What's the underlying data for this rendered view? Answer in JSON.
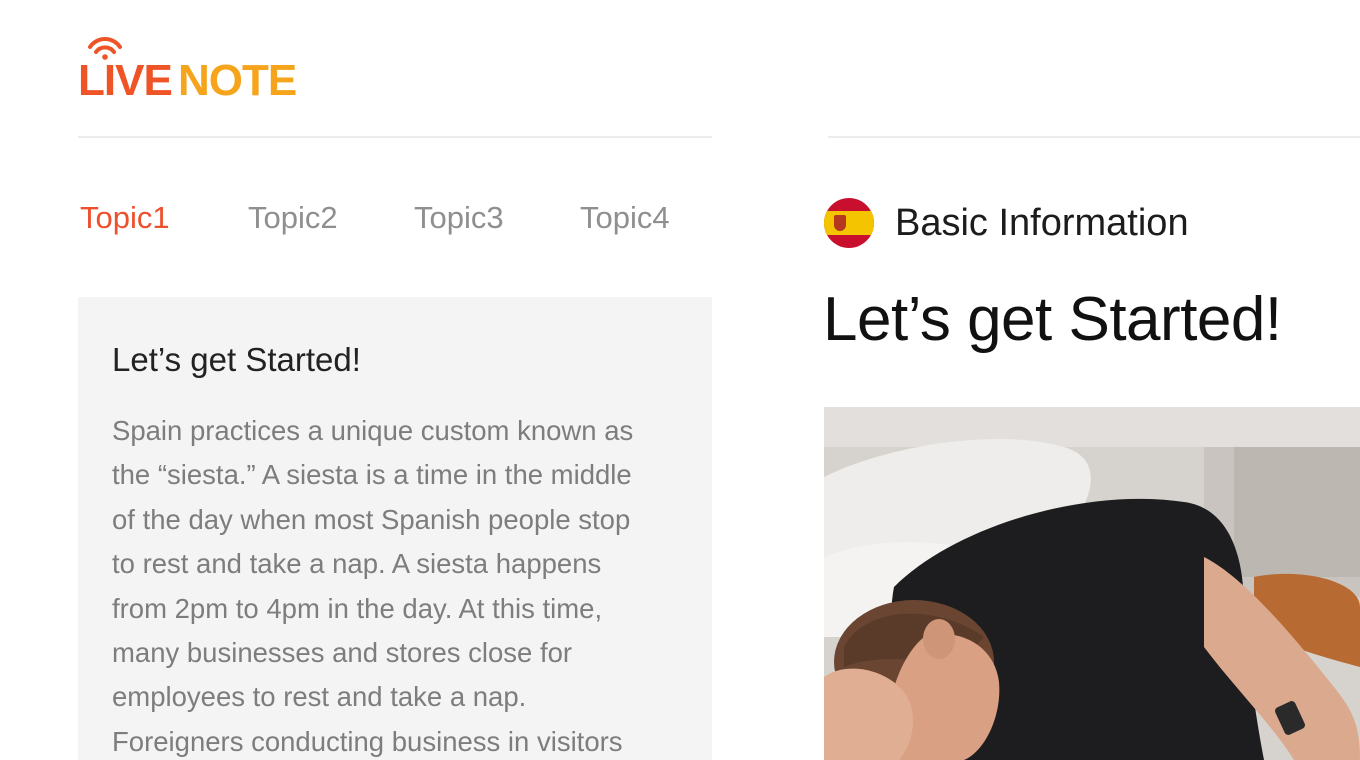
{
  "logo": {
    "live": "LIVE",
    "note": "NOTE",
    "colors": {
      "live": "#ee5426",
      "note": "#f6a41c"
    }
  },
  "tabs": [
    {
      "label": "Topic1",
      "active": true
    },
    {
      "label": "Topic2",
      "active": false
    },
    {
      "label": "Topic3",
      "active": false
    },
    {
      "label": "Topic4",
      "active": false
    }
  ],
  "card": {
    "title": "Let’s get Started!",
    "body_lines": [
      "Spain practices a unique custom known as",
      "the “siesta.” A siesta is a time in the middle",
      "of the day when most Spanish people stop",
      "to rest and take a nap. A siesta happens",
      "from 2pm to 4pm in the day. At this time,",
      "many businesses and stores close for",
      "employees to rest and take a nap.",
      "Foreigners conducting business in visitors"
    ]
  },
  "section": {
    "icon": "spain-flag-icon",
    "label": "Basic Information",
    "title": "Let’s get Started!"
  },
  "accent_color": "#ee4f2c"
}
